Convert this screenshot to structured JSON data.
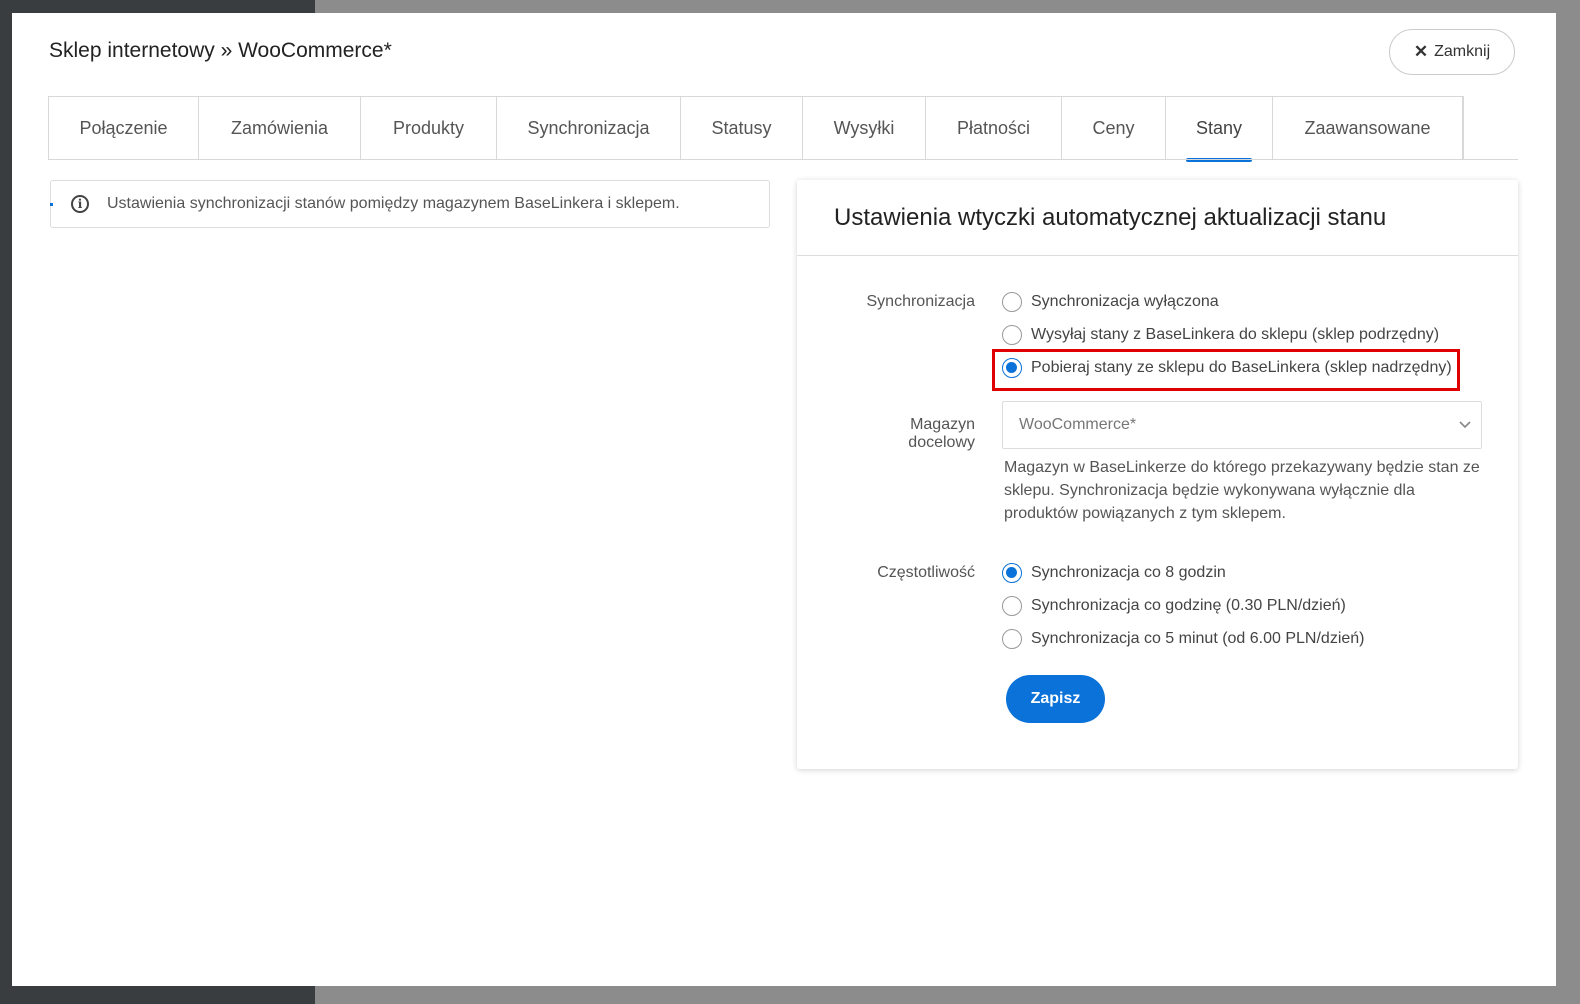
{
  "modal": {
    "title": "Sklep internetowy » WooCommerce*",
    "close_label": "Zamknij"
  },
  "tabs": [
    {
      "label": "Połączenie"
    },
    {
      "label": "Zamówienia"
    },
    {
      "label": "Produkty"
    },
    {
      "label": "Synchronizacja"
    },
    {
      "label": "Statusy"
    },
    {
      "label": "Wysyłki"
    },
    {
      "label": "Płatności"
    },
    {
      "label": "Ceny"
    },
    {
      "label": "Stany",
      "active": true
    },
    {
      "label": "Zaawansowane"
    }
  ],
  "info": {
    "text": "Ustawienia synchronizacji stanów pomiędzy magazynem BaseLinkera i sklepem."
  },
  "panel": {
    "title": "Ustawienia wtyczki automatycznej aktualizacji stanu",
    "sync": {
      "label": "Synchronizacja",
      "options": [
        {
          "label": "Synchronizacja wyłączona",
          "checked": false
        },
        {
          "label": "Wysyłaj stany z BaseLinkera do sklepu (sklep podrzędny)",
          "checked": false
        },
        {
          "label": "Pobieraj stany ze sklepu do BaseLinkera (sklep nadrzędny)",
          "checked": true
        }
      ]
    },
    "warehouse": {
      "label": "Magazyn docelowy",
      "value": "WooCommerce*",
      "help": "Magazyn w BaseLinkerze do którego przekazywany będzie stan ze sklepu. Synchronizacja będzie wykonywana wyłącznie dla produktów powiązanych z tym sklepem."
    },
    "frequency": {
      "label": "Częstotliwość",
      "options": [
        {
          "label": "Synchronizacja co 8 godzin",
          "checked": true
        },
        {
          "label": "Synchronizacja co godzinę (0.30 PLN/dzień)",
          "checked": false
        },
        {
          "label": "Synchronizacja co 5 minut (od 6.00 PLN/dzień)",
          "checked": false
        }
      ]
    },
    "save_label": "Zapisz"
  },
  "colors": {
    "accent": "#0b72d9",
    "highlight": "#e00000"
  }
}
